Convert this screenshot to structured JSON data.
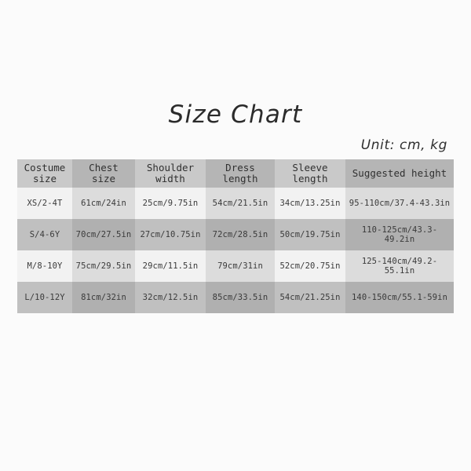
{
  "title": "Size Chart",
  "unit_note": "Unit: cm, kg",
  "colors": {
    "background": "#fbfbfb",
    "header_light": "#c9c9c9",
    "header_dark": "#b5b5b5",
    "row_odd_light": "#f2f2f2",
    "row_odd_dark": "#dcdcdc",
    "row_even_light": "#c0c0c0",
    "row_even_dark": "#b0b0b0",
    "text": "#3a3a3a"
  },
  "chart_data": {
    "type": "table",
    "title": "Size Chart",
    "subtitle": "Unit: cm, kg",
    "columns": [
      "Costume size",
      "Chest size",
      "Shoulder width",
      "Dress length",
      "Sleeve length",
      "Suggested height"
    ],
    "column_header_lines": [
      [
        "Costume",
        "size"
      ],
      [
        "Chest size"
      ],
      [
        "Shoulder",
        "width"
      ],
      [
        "Dress",
        "length"
      ],
      [
        "Sleeve",
        "length"
      ],
      [
        "Suggested height"
      ]
    ],
    "rows": [
      {
        "costume_size": "XS/2-4T",
        "chest_size": "61cm/24in",
        "shoulder_width": "25cm/9.75in",
        "dress_length": "54cm/21.5in",
        "sleeve_length": "34cm/13.25in",
        "suggested_height": "95-110cm/37.4-43.3in"
      },
      {
        "costume_size": "S/4-6Y",
        "chest_size": "70cm/27.5in",
        "shoulder_width": "27cm/10.75in",
        "dress_length": "72cm/28.5in",
        "sleeve_length": "50cm/19.75in",
        "suggested_height": "110-125cm/43.3-49.2in"
      },
      {
        "costume_size": "M/8-10Y",
        "chest_size": "75cm/29.5in",
        "shoulder_width": "29cm/11.5in",
        "dress_length": "79cm/31in",
        "sleeve_length": "52cm/20.75in",
        "suggested_height": "125-140cm/49.2-55.1in"
      },
      {
        "costume_size": "L/10-12Y",
        "chest_size": "81cm/32in",
        "shoulder_width": "32cm/12.5in",
        "dress_length": "85cm/33.5in",
        "sleeve_length": "54cm/21.25in",
        "suggested_height": "140-150cm/55.1-59in"
      }
    ]
  }
}
